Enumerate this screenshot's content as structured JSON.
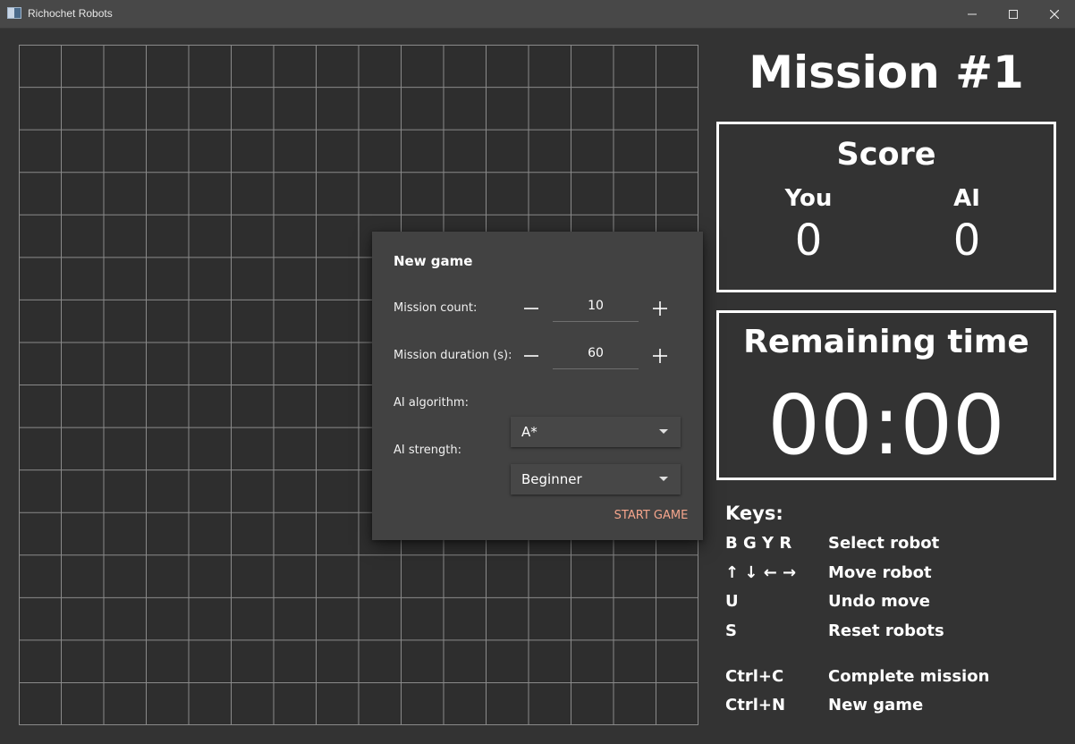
{
  "window": {
    "title": "Richochet Robots"
  },
  "board": {
    "columns": 16,
    "rows": 16,
    "grid_color": "#8a8a8a",
    "background": "#2e2e2e"
  },
  "dialog": {
    "title": "New game",
    "mission_count": {
      "label": "Mission count:",
      "value": "10"
    },
    "mission_duration": {
      "label": "Mission duration (s):",
      "value": "60"
    },
    "ai_algorithm": {
      "label": "AI algorithm:",
      "value": "A*"
    },
    "ai_strength": {
      "label": "AI strength:",
      "value": "Beginner"
    },
    "start_label": "START GAME",
    "accent_color": "#f5a58c"
  },
  "mission": {
    "title": "Mission #1"
  },
  "score": {
    "title": "Score",
    "you_label": "You",
    "ai_label": "AI",
    "you_value": "0",
    "ai_value": "0"
  },
  "remaining": {
    "title": "Remaining time",
    "time": "00:00"
  },
  "keys": {
    "title": "Keys:",
    "items": [
      {
        "key": "B G Y R",
        "desc": "Select robot"
      },
      {
        "key": "↑ ↓ ← →",
        "desc": "Move robot"
      },
      {
        "key": "U",
        "desc": "Undo move"
      },
      {
        "key": "S",
        "desc": "Reset robots"
      },
      {
        "key": "Ctrl+C",
        "desc": "Complete mission"
      },
      {
        "key": "Ctrl+N",
        "desc": "New game"
      }
    ]
  }
}
